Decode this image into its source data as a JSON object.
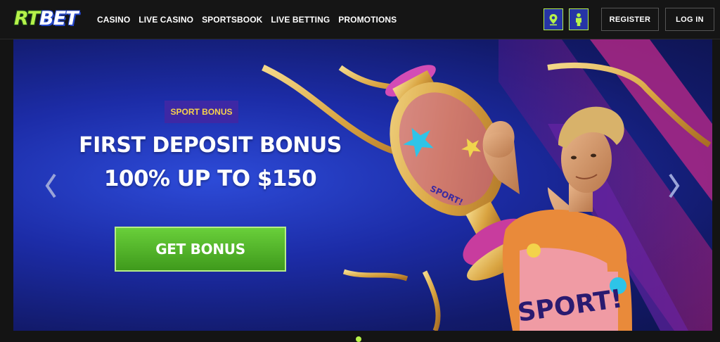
{
  "header": {
    "logo": {
      "part1": "RT",
      "part2": "BET"
    },
    "nav": [
      "CASINO",
      "LIVE CASINO",
      "SPORTSBOOK",
      "LIVE BETTING",
      "PROMOTIONS"
    ],
    "icons": [
      "map-pin-icon",
      "user-icon"
    ],
    "register_label": "REGISTER",
    "login_label": "LOG IN"
  },
  "banner": {
    "badge": "SPORT BONUS",
    "headline_line1": "FIRST DEPOSIT BONUS",
    "headline_line2": "100% UP TO $150",
    "cta_label": "GET BONUS",
    "trophy_text": "SPORT!",
    "shirt_text": "SPORT!"
  },
  "colors": {
    "accent": "#b6f24a",
    "banner_bg": "#1c2ca7",
    "badge_bg": "#3d28a5",
    "badge_text": "#f7d24c",
    "cta": "#4fb52a"
  }
}
